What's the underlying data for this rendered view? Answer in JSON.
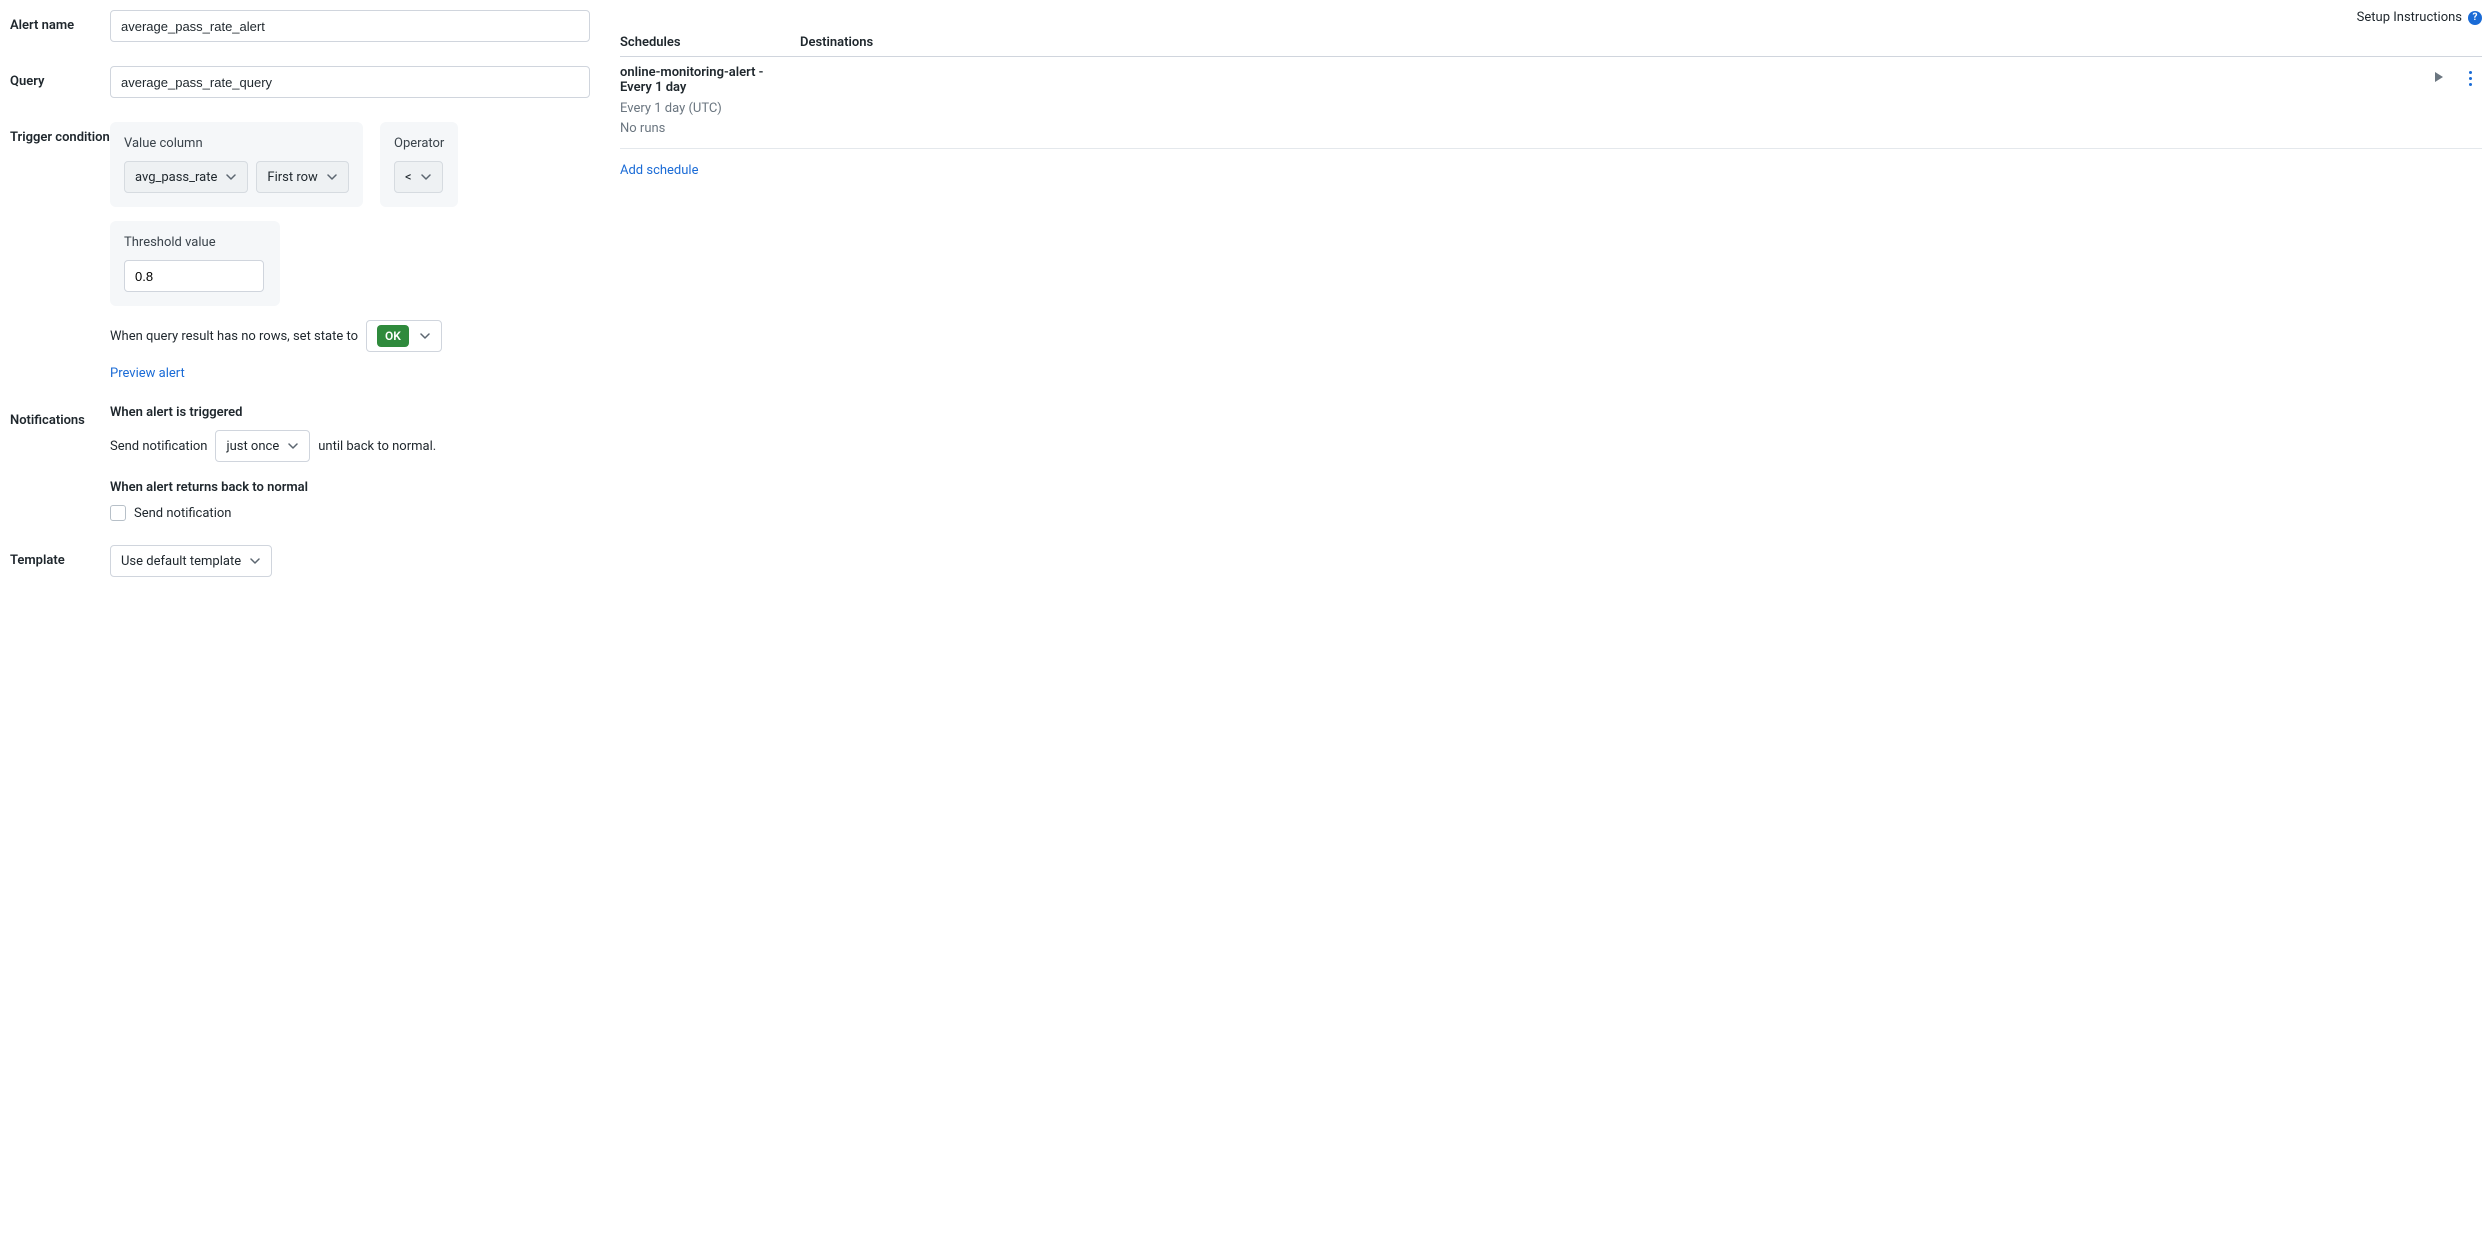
{
  "header": {
    "setup_instructions": "Setup Instructions"
  },
  "labels": {
    "alert_name": "Alert name",
    "query": "Query",
    "trigger_condition": "Trigger condition",
    "notifications": "Notifications",
    "template": "Template"
  },
  "alert_name_value": "average_pass_rate_alert",
  "query_value": "average_pass_rate_query",
  "trigger": {
    "value_column_label": "Value column",
    "value_column_selected": "avg_pass_rate",
    "row_selector_selected": "First row",
    "operator_label": "Operator",
    "operator_selected": "<",
    "threshold_label": "Threshold value",
    "threshold_value": "0.8",
    "no_rows_prefix": "When query result has no rows, set state to",
    "no_rows_state_pill": "OK",
    "preview_link": "Preview alert"
  },
  "notifications": {
    "triggered_heading": "When alert is triggered",
    "send_notification_prefix": "Send notification",
    "frequency_selected": "just once",
    "send_notification_suffix": "until back to normal.",
    "back_to_normal_heading": "When alert returns back to normal",
    "back_to_normal_checkbox_label": "Send notification",
    "back_to_normal_checked": false
  },
  "template": {
    "selected": "Use default template"
  },
  "schedules": {
    "col_schedules": "Schedules",
    "col_destinations": "Destinations",
    "items": [
      {
        "title": "online-monitoring-alert - Every 1 day",
        "interval": "Every 1 day (UTC)",
        "runs": "No runs"
      }
    ],
    "add_link": "Add schedule"
  }
}
